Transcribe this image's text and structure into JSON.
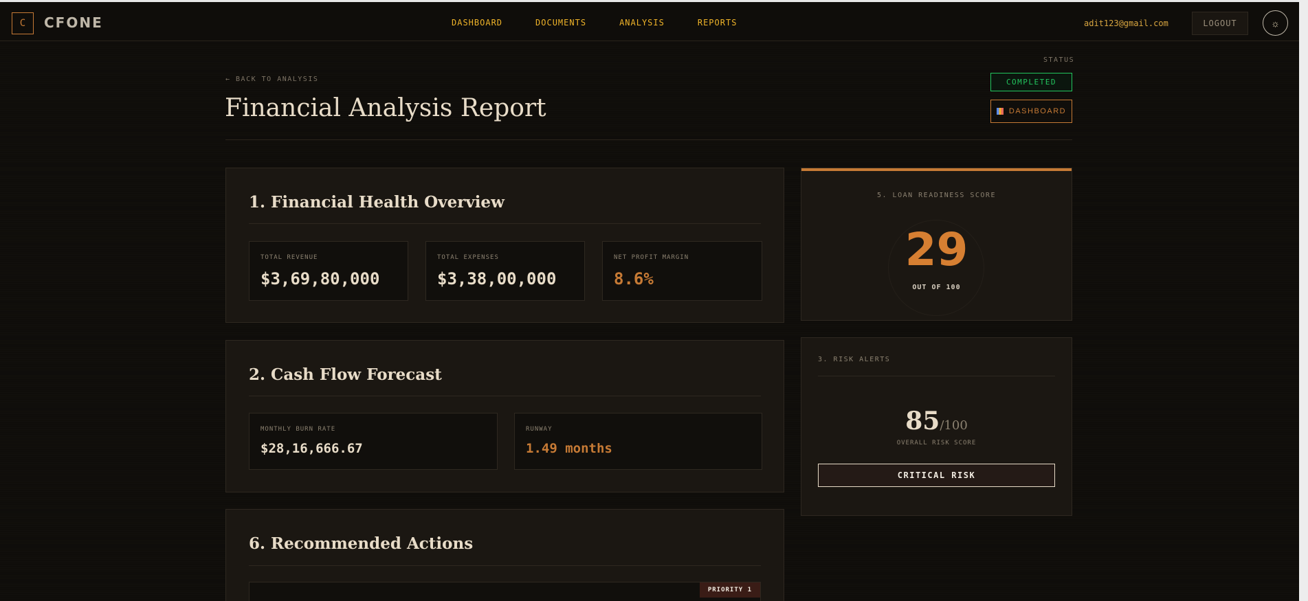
{
  "app": {
    "logo_letter": "C",
    "logo_text": "CFONE"
  },
  "nav": {
    "items": [
      "DASHBOARD",
      "DOCUMENTS",
      "ANALYSIS",
      "REPORTS"
    ]
  },
  "user": {
    "email": "adit123@gmail.com",
    "logout_label": "LOGOUT",
    "theme_icon": "sun-icon"
  },
  "header": {
    "back_link": "← BACK TO ANALYSIS",
    "title": "Financial Analysis Report",
    "status_label": "STATUS",
    "status_value": "COMPLETED",
    "dashboard_button": "DASHBOARD"
  },
  "colors": {
    "accent": "#c67a35",
    "success": "#22c55e",
    "nav": "#f0b429"
  },
  "health": {
    "title": "1. Financial Health Overview",
    "metrics": [
      {
        "label": "TOTAL REVENUE",
        "value": "$3,69,80,000"
      },
      {
        "label": "TOTAL EXPENSES",
        "value": "$3,38,00,000"
      },
      {
        "label": "NET PROFIT MARGIN",
        "value": "8.6%"
      }
    ]
  },
  "cashflow": {
    "title": "2. Cash Flow Forecast",
    "metrics": [
      {
        "label": "MONTHLY BURN RATE",
        "value": "$28,16,666.67"
      },
      {
        "label": "RUNWAY",
        "value": "1.49 months"
      }
    ]
  },
  "actions": {
    "title": "6. Recommended Actions",
    "priority": "PRIORITY 1"
  },
  "loan": {
    "label": "5. LOAN READINESS SCORE",
    "score": "29",
    "out_of": "OUT OF 100"
  },
  "risk": {
    "label": "3. RISK ALERTS",
    "score": "85",
    "denominator": "/100",
    "sub": "OVERALL RISK SCORE",
    "badge": "CRITICAL RISK"
  }
}
